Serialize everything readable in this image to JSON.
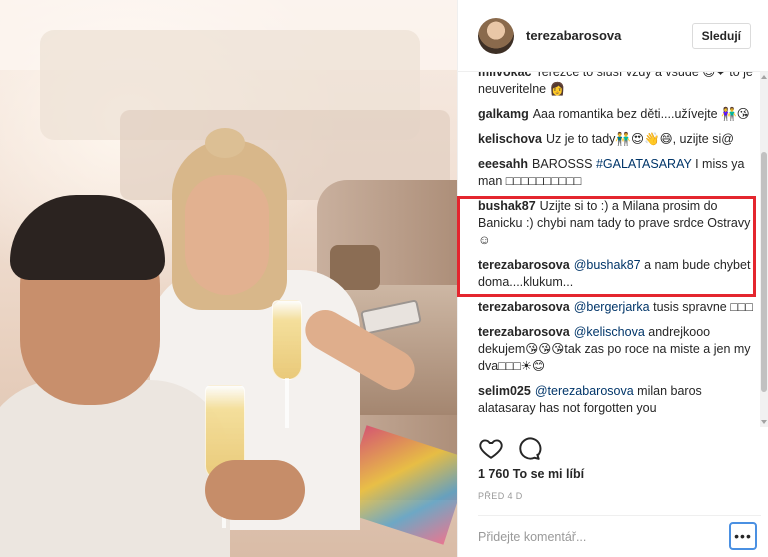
{
  "post": {
    "username": "terezabarosova",
    "follow_label": "Sledují",
    "likes_text": "1 760 To se mi líbí",
    "time_text": "PŘED 4 D",
    "comment_placeholder": "Přidejte komentář...",
    "more_label": "•••"
  },
  "comments": [
    {
      "user": "milvokac",
      "text": "Terezce to sluší vždy a všude 😊❤ to je neuveritelne 👩"
    },
    {
      "user": "galkamg",
      "text": "Aaa romantika bez děti....užívejte 👫😘"
    },
    {
      "user": "kelischova",
      "text": "Uz je to tady👬😍👋😄, uzijte si@"
    },
    {
      "user": "eeesahh",
      "pre": "BAROSSS ",
      "mention": "#GALATASARAY",
      "text": " I miss ya man □□□□□□□□□□"
    },
    {
      "user": "bushak87",
      "text": "Uzijte si to :) a Milana prosim do Banicku :) chybi nam tady to prave srdce Ostravy ☺"
    },
    {
      "user": "terezabarosova",
      "mention": "@bushak87",
      "text": " a nam bude chybet doma....klukum..."
    },
    {
      "user": "terezabarosova",
      "mention": "@bergerjarka",
      "text": " tusis spravne □□□"
    },
    {
      "user": "terezabarosova",
      "mention": "@kelischova",
      "text": " andrejkooo dekujem😘😘😘tak zas po roce na miste a jen my dva□□□☀😊"
    },
    {
      "user": "selim025",
      "mention": "@terezabarosova",
      "text": " milan baros alatasaray has not forgotten you"
    }
  ],
  "icons": {
    "like": "heart-outline-icon",
    "comment": "speech-bubble-icon",
    "more": "ellipsis-icon"
  },
  "colors": {
    "highlight": "#e4262e",
    "mention": "#003569",
    "focus": "#4a90e2"
  }
}
